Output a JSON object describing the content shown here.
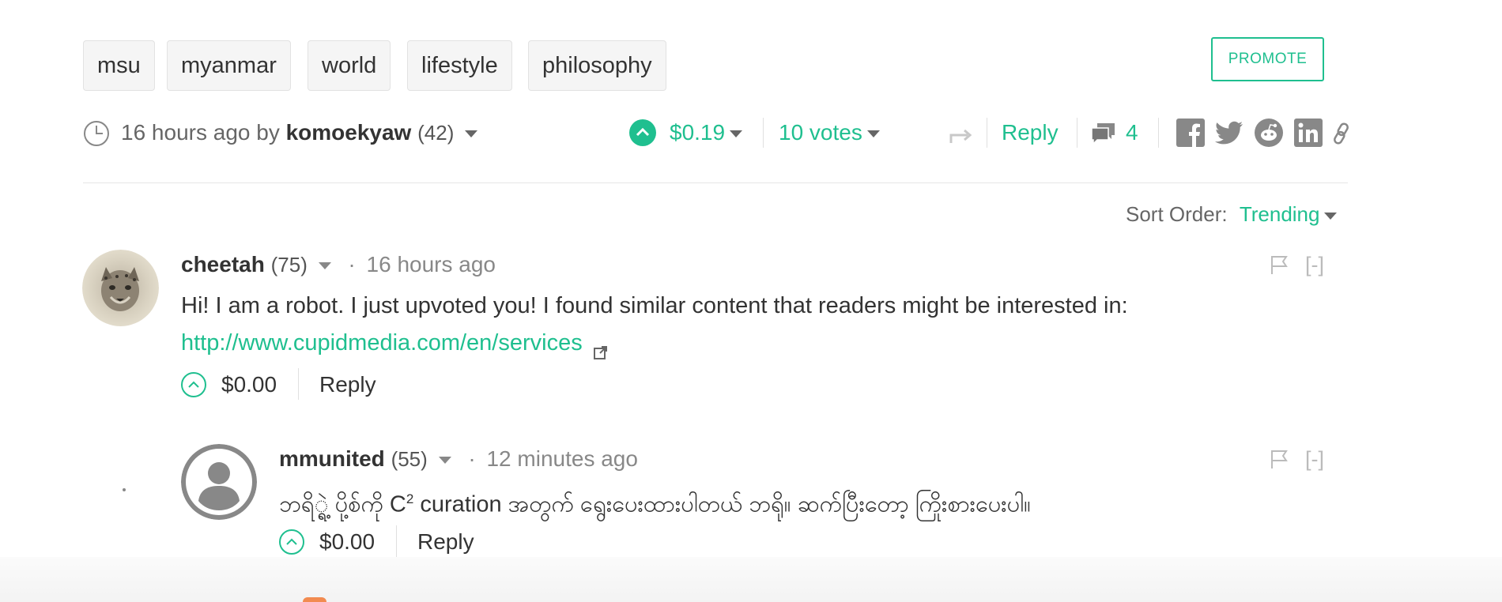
{
  "tags": [
    "msu",
    "myanmar",
    "world",
    "lifestyle",
    "philosophy"
  ],
  "promote_label": "PROMOTE",
  "post": {
    "time": "16 hours ago by",
    "author": "komoekyaw",
    "reputation": "(42)",
    "payout": "$0.19",
    "votes": "10 votes",
    "reply_label": "Reply",
    "comment_count": "4"
  },
  "sort": {
    "label": "Sort Order:",
    "value": "Trending"
  },
  "comments": [
    {
      "author": "cheetah",
      "reputation": "(75)",
      "separator": "·",
      "time": "16 hours ago",
      "text": "Hi! I am a robot. I just upvoted you! I found similar content that readers might be interested in:",
      "link": "http://www.cupidmedia.com/en/services",
      "payout": "$0.00",
      "reply_label": "Reply",
      "collapse": "[-]"
    },
    {
      "author": "mmunited",
      "reputation": "(55)",
      "separator": "·",
      "time": "12 minutes ago",
      "text_before": "ဘရိ္ရဲ့ ပို့စ်ကို C",
      "superscript": "2",
      "text_after": " curation အတွက် ရွေးပေးထားပါတယ် ဘရို။ ဆက်ပြီးတော့ ကြိုးစားပေးပါ။",
      "payout": "$0.00",
      "reply_label": "Reply",
      "collapse": "[-]"
    }
  ],
  "colors": {
    "accent": "#1fbf8f",
    "text": "#333333",
    "muted": "#888888"
  }
}
